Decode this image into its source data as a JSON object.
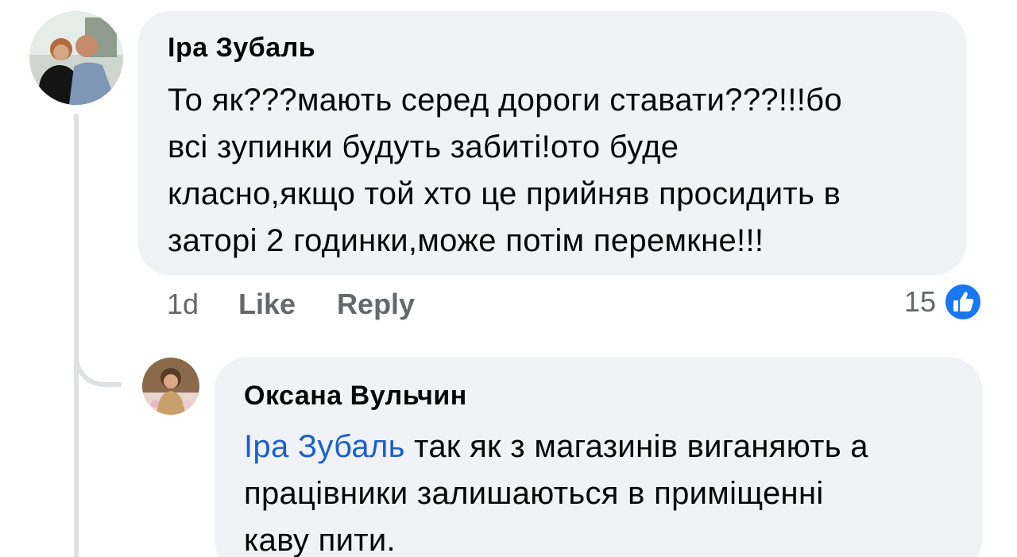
{
  "comment": {
    "author": "Іра Зубаль",
    "text": "То як???мають серед дороги ставати???!!!бо всі зупинки будуть забиті!ото буде класно,якщо той хто це прийняв просидить в заторі 2 годинки,може потім перемкне!!!",
    "lines": [
      "То як???мають серед дороги ставати???!!!бо",
      "всі зупинки будуть забиті!ото буде",
      "класно,якщо той хто це прийняв просидить в",
      "заторі 2 годинки,може потім перемкне!!!"
    ],
    "time": "1d",
    "like_label": "Like",
    "reply_label": "Reply",
    "reaction_count": "15",
    "reaction_icon": "like-icon",
    "reaction_color": "#1877f2"
  },
  "reply": {
    "author": "Оксана Вульчин",
    "mention": "Іра Зубаль",
    "lines": [
      "так як з магазинів виганяють а",
      "працівники залишаються в приміщенні",
      "каву пити."
    ],
    "mention_color": "#1b5fd0"
  }
}
